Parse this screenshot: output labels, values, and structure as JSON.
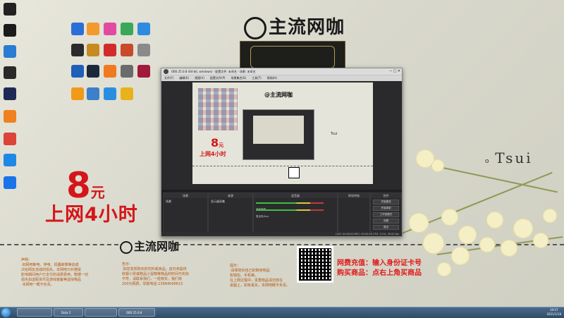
{
  "desktop": {
    "brand": "主流网咖",
    "left_icons": [
      {
        "name": "epic-games",
        "label": "",
        "color": "#222"
      },
      {
        "name": "logitech-g",
        "label": "",
        "color": "#1b1b1b"
      },
      {
        "name": "app-circle",
        "label": "",
        "color": "#2b7cd3"
      },
      {
        "name": "obs-studio",
        "label": "",
        "color": "#2a2a2a"
      },
      {
        "name": "app-dark",
        "label": "",
        "color": "#1e2a55"
      },
      {
        "name": "app-orange",
        "label": "",
        "color": "#f08020"
      },
      {
        "name": "google-chrome",
        "label": "",
        "color": "#db4437"
      },
      {
        "name": "app-cloud",
        "label": "",
        "color": "#1e88e5"
      },
      {
        "name": "internet-explorer",
        "label": "",
        "color": "#1a73e8"
      }
    ],
    "grid_icons": [
      {
        "name": "icon-r1-1",
        "color": "#2a6fd6"
      },
      {
        "name": "icon-r1-2",
        "color": "#f29a2e"
      },
      {
        "name": "icon-r1-3",
        "color": "#e04ba0"
      },
      {
        "name": "icon-r1-4",
        "color": "#3aa858"
      },
      {
        "name": "icon-r1-5",
        "color": "#2d8be0"
      },
      {
        "name": "icon-r2-1",
        "color": "#2b2b2b"
      },
      {
        "name": "icon-r2-2",
        "color": "#c88a1e"
      },
      {
        "name": "icon-r2-3",
        "color": "#d12b2b"
      },
      {
        "name": "icon-r2-4",
        "color": "#c84a2a"
      },
      {
        "name": "icon-r2-5",
        "color": "#8a8a8a"
      },
      {
        "name": "icon-r3-1",
        "color": "#1e5fb8"
      },
      {
        "name": "icon-r3-2",
        "color": "#1b2838"
      },
      {
        "name": "icon-r3-3",
        "color": "#f07a20"
      },
      {
        "name": "icon-r3-4",
        "color": "#6b6b6b"
      },
      {
        "name": "icon-r3-5",
        "color": "#a01a3a"
      },
      {
        "name": "icon-r4-1",
        "color": "#f09a1a"
      },
      {
        "name": "icon-r4-2",
        "color": "#3b80c8"
      },
      {
        "name": "icon-r4-3",
        "color": "#2a8ee0"
      },
      {
        "name": "icon-r4-4",
        "color": "#e8b31a"
      }
    ],
    "promo": {
      "price_num": "8",
      "price_unit": "元",
      "slogan": "上网4小时"
    },
    "notice1": "声明：\n·如网吧断电、停电、机器故障等造成\n次给网友造成的损失，本网吧只补偿受\n影响期间用户已支付的消费费用，赔偿一切\n损失如虚假货币及游戏装备等虚拟物品\n·本网吧一概不负责。",
    "notice2": "告示：\n·如您发现购买的饮料或食品，店内未提供\n收银小票或赠品小蛋糕等物品的时间与实际\n不符，请联系我们，一经核实，我们将\n200元网费，举报电话:13684006613",
    "notice3": "提示：\n·请保管好自己的随身物品\n如钱包、手机等。\n在上网过程中，贵重物品请勿放在\n桌面上，如有丢失，本网吧概不负责。",
    "qr_text1": "网费充值：输入身份证卡号",
    "qr_text2": "购买商品：点右上角买商品",
    "tsui": "Tsui"
  },
  "obs": {
    "title": "OBS 25.0.8 (64-bit, windows) - 配置文件: 未命名 - 场景: 未命名",
    "menu": [
      "文件(F)",
      "编辑(E)",
      "视图(V)",
      "配置文件(P)",
      "场景集合(S)",
      "工具(T)",
      "帮助(H)"
    ],
    "preview_brand": "@主流网咖",
    "preview_price": "8",
    "preview_unit": "元",
    "preview_slogan": "上网4小时",
    "preview_tsui": "Tsui",
    "docks": {
      "scenes": "场景",
      "scene_item": "场景",
      "sources": "来源",
      "source_item": "显示器采集",
      "mixer": "混音器",
      "mixer_rows": [
        "桌面音频",
        "麦克风/Aux"
      ],
      "transitions": "转场特效",
      "controls": "控件",
      "control_buttons": [
        "开始推流",
        "开始录制",
        "工作室模式",
        "设置",
        "退出"
      ]
    },
    "status": "LIVE: 00:00:00   REC: 00:00:00   CPU: 3.2%, 30.00 fps"
  },
  "taskbar": {
    "tasks": [
      "",
      "Dota 2",
      "",
      "OBS 25.0.8"
    ],
    "time": "19:57",
    "date": "2021/1/18"
  }
}
